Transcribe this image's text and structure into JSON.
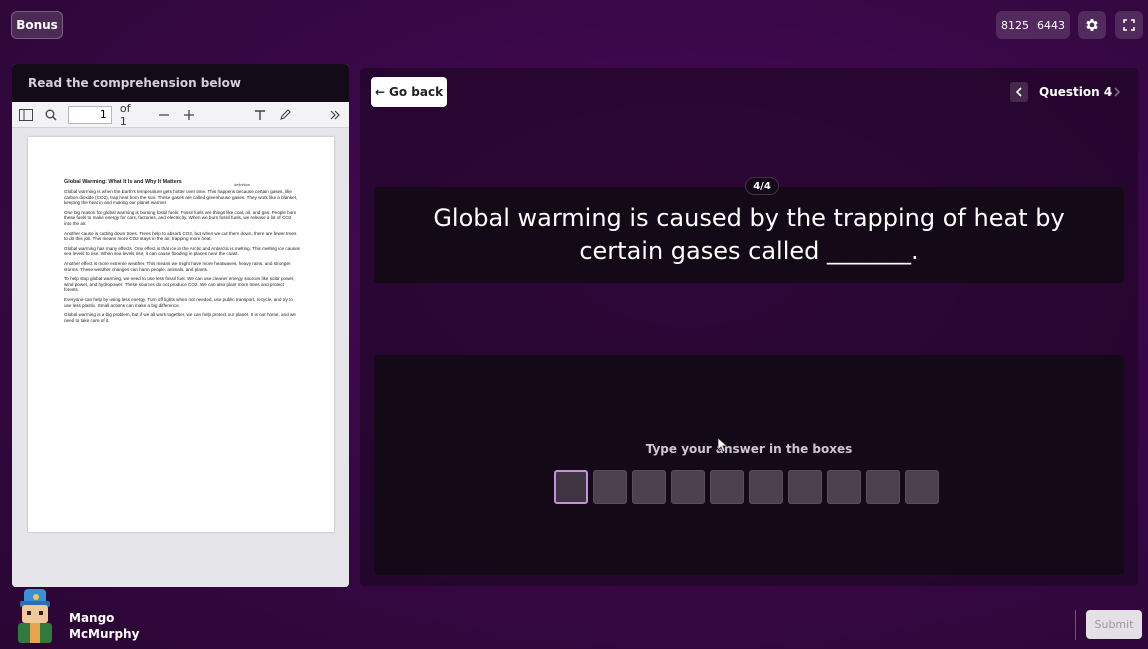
{
  "header": {
    "bonus_label": "Bonus",
    "code_part1": "8125",
    "code_part2": "6443"
  },
  "left_panel": {
    "title": "Read the comprehension below",
    "toolbar": {
      "page_value": "1",
      "page_total": "of 1"
    },
    "document": {
      "title": "Global Warming: What It Is and Why It Matters",
      "annotation": "definition",
      "paragraphs": [
        "Global warming is when the Earth's temperature gets hotter over time. This happens because certain gases, like carbon dioxide (CO2), trap heat from the sun. These gases are called greenhouse gases. They work like a blanket, keeping the heat in and making our planet warmer.",
        "One big reason for global warming is burning fossil fuels. Fossil fuels are things like coal, oil, and gas. People burn these fuels to make energy for cars, factories, and electricity. When we burn fossil fuels, we release a lot of CO2 into the air.",
        "Another cause is cutting down trees. Trees help to absorb CO2, but when we cut them down, there are fewer trees to do this job. This means more CO2 stays in the air, trapping more heat.",
        "Global warming has many effects. One effect is that ice in the Arctic and Antarctic is melting. This melting ice causes sea levels to rise. When sea levels rise, it can cause flooding in places near the coast.",
        "Another effect is more extreme weather. This means we might have more heatwaves, heavy rains, and stronger storms. These weather changes can harm people, animals, and plants.",
        "To help stop global warming, we need to use less fossil fuel. We can use cleaner energy sources like solar power, wind power, and hydropower. These sources do not produce CO2. We can also plant more trees and protect forests.",
        "Everyone can help by using less energy. Turn off lights when not needed, use public transport, recycle, and try to use less plastic. Small actions can make a big difference.",
        "Global warming is a big problem, but if we all work together, we can help protect our planet. It is our home, and we need to take care of it."
      ]
    }
  },
  "right_panel": {
    "go_back_label": "Go back",
    "question_label": "Question 4",
    "question_count": "4/4",
    "question_text": "Global warming is caused by the trapping of heat by certain gases called _______.",
    "answer_hint": "Type your answer in the boxes",
    "answer_box_count": 10
  },
  "footer": {
    "player_first": "Mango",
    "player_last": "McMurphy",
    "submit_label": "Submit"
  }
}
